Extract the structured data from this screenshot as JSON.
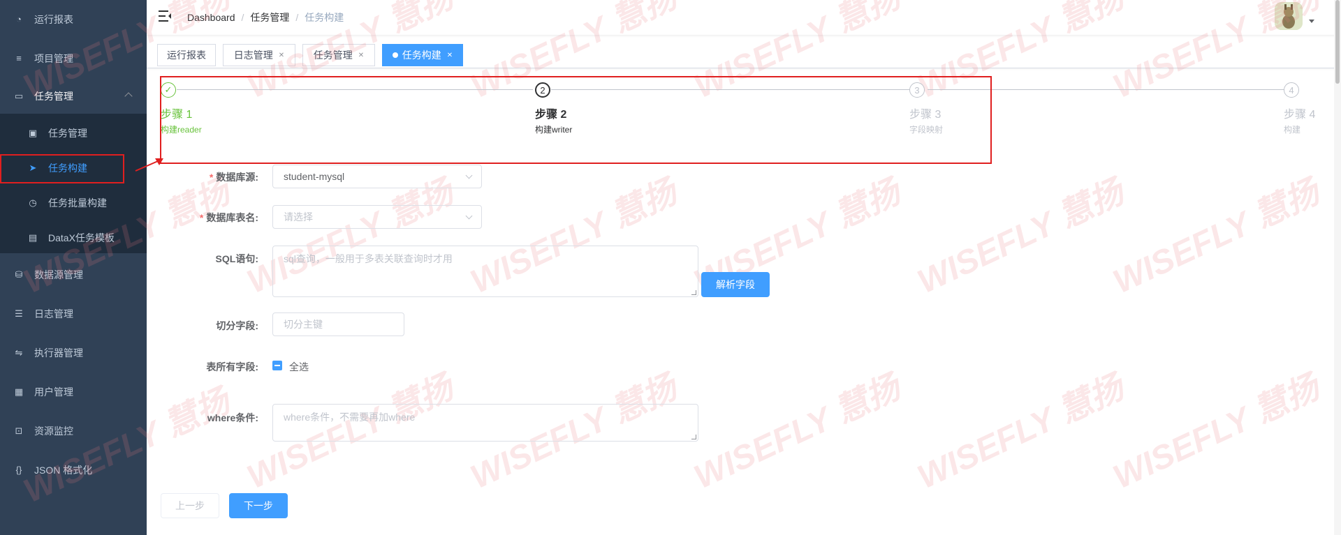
{
  "sidebar": {
    "items": [
      {
        "label": "运行报表",
        "icon": "dashboard-icon"
      },
      {
        "label": "项目管理",
        "icon": "database-icon"
      },
      {
        "label": "任务管理",
        "icon": "monitor-icon"
      },
      {
        "label": "数据源管理",
        "icon": "datasource-icon"
      },
      {
        "label": "日志管理",
        "icon": "log-icon"
      },
      {
        "label": "执行器管理",
        "icon": "executor-icon"
      },
      {
        "label": "用户管理",
        "icon": "user-table-icon"
      },
      {
        "label": "资源监控",
        "icon": "monitor-resource-icon"
      },
      {
        "label": "JSON 格式化",
        "icon": "braces-icon"
      }
    ],
    "task_submenu": [
      {
        "label": "任务管理",
        "icon": "task-icon"
      },
      {
        "label": "任务构建",
        "icon": "send-icon"
      },
      {
        "label": "任务批量构建",
        "icon": "batch-icon"
      },
      {
        "label": "DataX任务模板",
        "icon": "template-icon"
      }
    ],
    "active_color": "#409eff"
  },
  "header": {
    "breadcrumb": [
      "Dashboard",
      "任务管理",
      "任务构建"
    ]
  },
  "tags": [
    {
      "label": "运行报表",
      "closable": false
    },
    {
      "label": "日志管理",
      "closable": true
    },
    {
      "label": "任务管理",
      "closable": true
    },
    {
      "label": "任务构建",
      "closable": true,
      "active": true
    }
  ],
  "steps": [
    {
      "title": "步骤 1",
      "desc": "构建reader",
      "status": "finish"
    },
    {
      "title": "步骤 2",
      "desc": "构建writer",
      "status": "process",
      "number": "2"
    },
    {
      "title": "步骤 3",
      "desc": "字段映射",
      "status": "wait",
      "number": "3"
    },
    {
      "title": "步骤 4",
      "desc": "构建",
      "status": "wait",
      "number": "4"
    }
  ],
  "form": {
    "datasource_label": "数据库源:",
    "datasource_value": "student-mysql",
    "table_label": "数据库表名:",
    "table_placeholder": "请选择",
    "sql_label": "SQL语句:",
    "sql_placeholder": "sql查询，一般用于多表关联查询时才用",
    "parse_button": "解析字段",
    "split_label": "切分字段:",
    "split_placeholder": "切分主键",
    "fields_label": "表所有字段:",
    "select_all": "全选",
    "where_label": "where条件:",
    "where_placeholder": "where条件，不需要再加where"
  },
  "buttons": {
    "prev": "上一步",
    "next": "下一步"
  },
  "watermark": "WISEFLY 慧扬"
}
